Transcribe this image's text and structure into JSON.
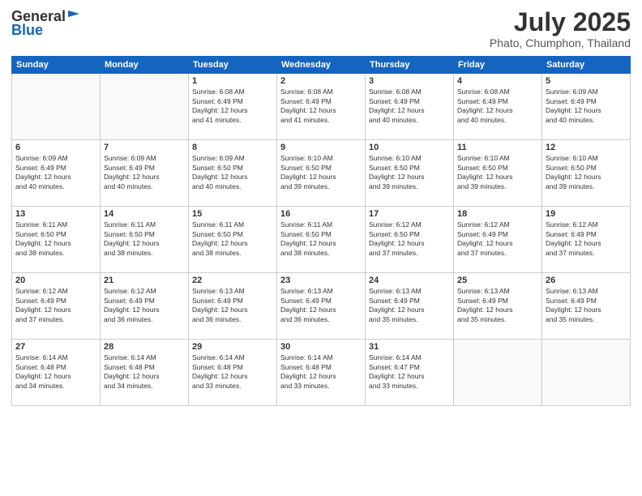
{
  "header": {
    "logo_general": "General",
    "logo_blue": "Blue",
    "main_title": "July 2025",
    "sub_title": "Phato, Chumphon, Thailand"
  },
  "calendar": {
    "days_of_week": [
      "Sunday",
      "Monday",
      "Tuesday",
      "Wednesday",
      "Thursday",
      "Friday",
      "Saturday"
    ],
    "weeks": [
      [
        {
          "day": "",
          "info": ""
        },
        {
          "day": "",
          "info": ""
        },
        {
          "day": "1",
          "info": "Sunrise: 6:08 AM\nSunset: 6:49 PM\nDaylight: 12 hours\nand 41 minutes."
        },
        {
          "day": "2",
          "info": "Sunrise: 6:08 AM\nSunset: 6:49 PM\nDaylight: 12 hours\nand 41 minutes."
        },
        {
          "day": "3",
          "info": "Sunrise: 6:08 AM\nSunset: 6:49 PM\nDaylight: 12 hours\nand 40 minutes."
        },
        {
          "day": "4",
          "info": "Sunrise: 6:08 AM\nSunset: 6:49 PM\nDaylight: 12 hours\nand 40 minutes."
        },
        {
          "day": "5",
          "info": "Sunrise: 6:09 AM\nSunset: 6:49 PM\nDaylight: 12 hours\nand 40 minutes."
        }
      ],
      [
        {
          "day": "6",
          "info": "Sunrise: 6:09 AM\nSunset: 6:49 PM\nDaylight: 12 hours\nand 40 minutes."
        },
        {
          "day": "7",
          "info": "Sunrise: 6:09 AM\nSunset: 6:49 PM\nDaylight: 12 hours\nand 40 minutes."
        },
        {
          "day": "8",
          "info": "Sunrise: 6:09 AM\nSunset: 6:50 PM\nDaylight: 12 hours\nand 40 minutes."
        },
        {
          "day": "9",
          "info": "Sunrise: 6:10 AM\nSunset: 6:50 PM\nDaylight: 12 hours\nand 39 minutes."
        },
        {
          "day": "10",
          "info": "Sunrise: 6:10 AM\nSunset: 6:50 PM\nDaylight: 12 hours\nand 39 minutes."
        },
        {
          "day": "11",
          "info": "Sunrise: 6:10 AM\nSunset: 6:50 PM\nDaylight: 12 hours\nand 39 minutes."
        },
        {
          "day": "12",
          "info": "Sunrise: 6:10 AM\nSunset: 6:50 PM\nDaylight: 12 hours\nand 39 minutes."
        }
      ],
      [
        {
          "day": "13",
          "info": "Sunrise: 6:11 AM\nSunset: 6:50 PM\nDaylight: 12 hours\nand 38 minutes."
        },
        {
          "day": "14",
          "info": "Sunrise: 6:11 AM\nSunset: 6:50 PM\nDaylight: 12 hours\nand 38 minutes."
        },
        {
          "day": "15",
          "info": "Sunrise: 6:11 AM\nSunset: 6:50 PM\nDaylight: 12 hours\nand 38 minutes."
        },
        {
          "day": "16",
          "info": "Sunrise: 6:11 AM\nSunset: 6:50 PM\nDaylight: 12 hours\nand 38 minutes."
        },
        {
          "day": "17",
          "info": "Sunrise: 6:12 AM\nSunset: 6:50 PM\nDaylight: 12 hours\nand 37 minutes."
        },
        {
          "day": "18",
          "info": "Sunrise: 6:12 AM\nSunset: 6:49 PM\nDaylight: 12 hours\nand 37 minutes."
        },
        {
          "day": "19",
          "info": "Sunrise: 6:12 AM\nSunset: 6:49 PM\nDaylight: 12 hours\nand 37 minutes."
        }
      ],
      [
        {
          "day": "20",
          "info": "Sunrise: 6:12 AM\nSunset: 6:49 PM\nDaylight: 12 hours\nand 37 minutes."
        },
        {
          "day": "21",
          "info": "Sunrise: 6:12 AM\nSunset: 6:49 PM\nDaylight: 12 hours\nand 36 minutes."
        },
        {
          "day": "22",
          "info": "Sunrise: 6:13 AM\nSunset: 6:49 PM\nDaylight: 12 hours\nand 36 minutes."
        },
        {
          "day": "23",
          "info": "Sunrise: 6:13 AM\nSunset: 6:49 PM\nDaylight: 12 hours\nand 36 minutes."
        },
        {
          "day": "24",
          "info": "Sunrise: 6:13 AM\nSunset: 6:49 PM\nDaylight: 12 hours\nand 35 minutes."
        },
        {
          "day": "25",
          "info": "Sunrise: 6:13 AM\nSunset: 6:49 PM\nDaylight: 12 hours\nand 35 minutes."
        },
        {
          "day": "26",
          "info": "Sunrise: 6:13 AM\nSunset: 6:49 PM\nDaylight: 12 hours\nand 35 minutes."
        }
      ],
      [
        {
          "day": "27",
          "info": "Sunrise: 6:14 AM\nSunset: 6:48 PM\nDaylight: 12 hours\nand 34 minutes."
        },
        {
          "day": "28",
          "info": "Sunrise: 6:14 AM\nSunset: 6:48 PM\nDaylight: 12 hours\nand 34 minutes."
        },
        {
          "day": "29",
          "info": "Sunrise: 6:14 AM\nSunset: 6:48 PM\nDaylight: 12 hours\nand 33 minutes."
        },
        {
          "day": "30",
          "info": "Sunrise: 6:14 AM\nSunset: 6:48 PM\nDaylight: 12 hours\nand 33 minutes."
        },
        {
          "day": "31",
          "info": "Sunrise: 6:14 AM\nSunset: 6:47 PM\nDaylight: 12 hours\nand 33 minutes."
        },
        {
          "day": "",
          "info": ""
        },
        {
          "day": "",
          "info": ""
        }
      ]
    ]
  }
}
